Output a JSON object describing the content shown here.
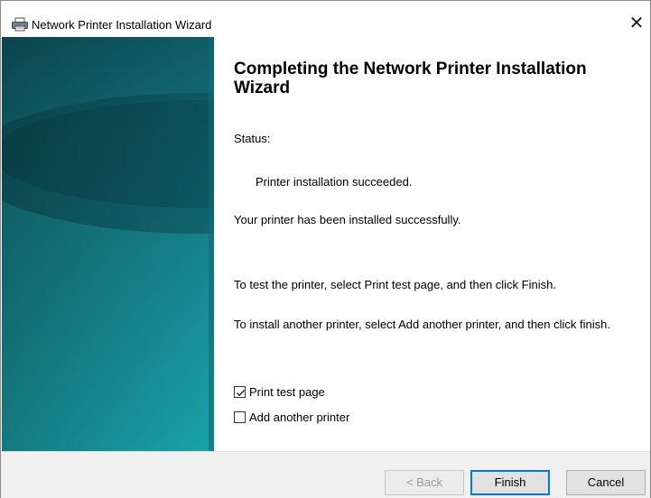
{
  "window": {
    "title": "Network Printer Installation Wizard",
    "close_label": "✕"
  },
  "icons": {
    "title_icon": "printer-icon",
    "close_icon": "close-icon",
    "check_icon": "checkmark-icon"
  },
  "colors": {
    "sidebar_dark": "#0f5c66",
    "sidebar_light": "#1aa3ab",
    "default_button_border": "#0078d7"
  },
  "main": {
    "heading": "Completing the Network Printer Installation Wizard",
    "status_label": "Status:",
    "status_value": "Printer installation succeeded.",
    "success_message": "Your printer has been installed successfully.",
    "test_instruction": "To test the printer, select Print test page, and then click Finish.",
    "another_instruction": "To install another printer, select Add another printer, and then click finish.",
    "checkboxes": [
      {
        "label": "Print test page",
        "checked": true
      },
      {
        "label": "Add another printer",
        "checked": false
      }
    ]
  },
  "buttons": {
    "back": "< Back",
    "finish": "Finish",
    "cancel": "Cancel"
  }
}
